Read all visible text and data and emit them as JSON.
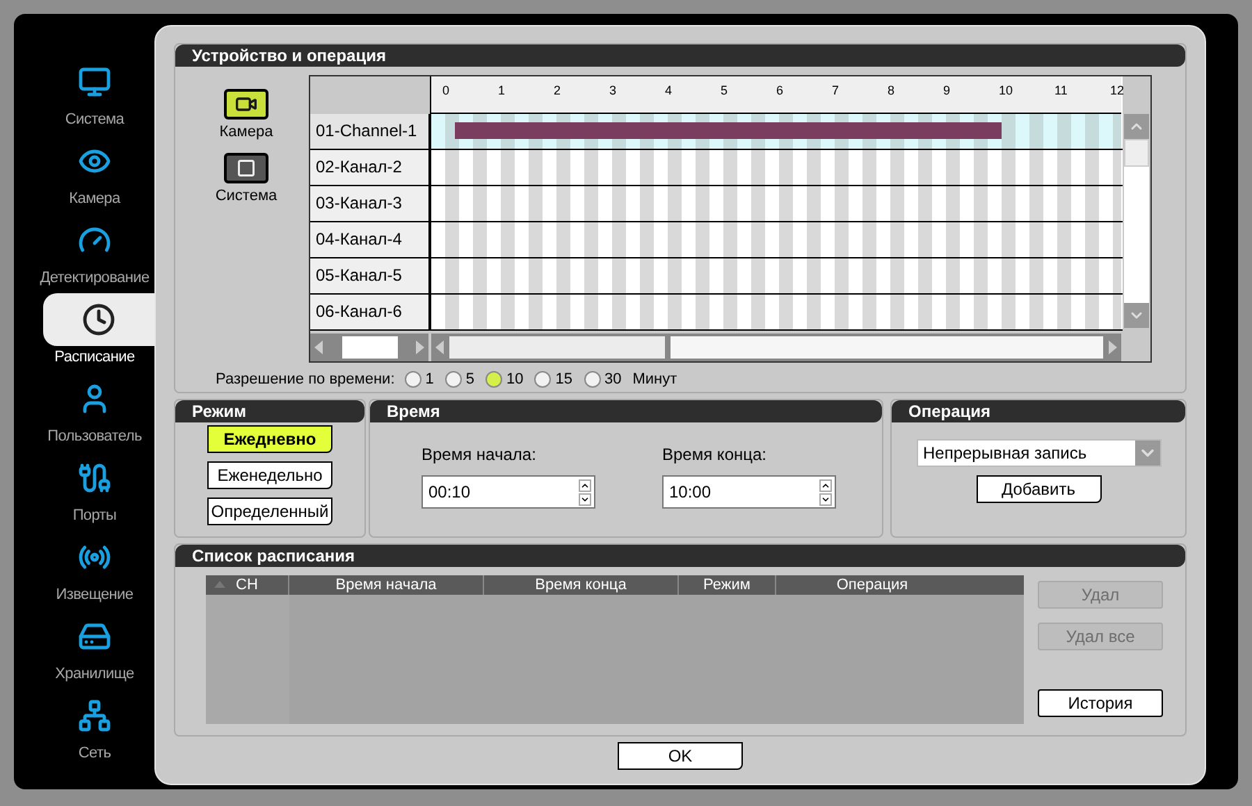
{
  "sidebar": {
    "items": [
      {
        "label": "Система",
        "selected": false
      },
      {
        "label": "Камера",
        "selected": false
      },
      {
        "label": "Детектирование",
        "selected": false
      },
      {
        "label": "Расписание",
        "selected": true
      },
      {
        "label": "Пользователь",
        "selected": false
      },
      {
        "label": "Порты",
        "selected": false
      },
      {
        "label": "Извещение",
        "selected": false
      },
      {
        "label": "Хранилище",
        "selected": false
      },
      {
        "label": "Сеть",
        "selected": false
      }
    ]
  },
  "device_section": {
    "title": "Устройство и операция",
    "device_types": [
      {
        "label": "Камера",
        "selected": true
      },
      {
        "label": "Система",
        "selected": false
      }
    ],
    "timeline": {
      "hour_ticks": [
        "0",
        "1",
        "2",
        "3",
        "4",
        "5",
        "6",
        "7",
        "8",
        "9",
        "10",
        "11",
        "12"
      ],
      "channels": [
        {
          "name": "01-Channel-1",
          "selected": true,
          "scheduled": true
        },
        {
          "name": "02-Канал-2",
          "selected": false,
          "scheduled": false
        },
        {
          "name": "03-Канал-3",
          "selected": false,
          "scheduled": false
        },
        {
          "name": "04-Канал-4",
          "selected": false,
          "scheduled": false
        },
        {
          "name": "05-Канал-5",
          "selected": false,
          "scheduled": false
        },
        {
          "name": "06-Канал-6",
          "selected": false,
          "scheduled": false
        }
      ]
    },
    "time_resolution": {
      "label": "Разрешение по времени:",
      "options": [
        {
          "label": "1",
          "selected": false
        },
        {
          "label": "5",
          "selected": false
        },
        {
          "label": "10",
          "selected": true
        },
        {
          "label": "15",
          "selected": false
        },
        {
          "label": "30",
          "selected": false
        }
      ],
      "unit": "Минут"
    }
  },
  "mode_section": {
    "title": "Режим",
    "modes": [
      {
        "label": "Ежедневно",
        "selected": true
      },
      {
        "label": "Еженедельно",
        "selected": false
      },
      {
        "label": "Определенный",
        "selected": false
      }
    ]
  },
  "time_section": {
    "title": "Время",
    "start": {
      "label": "Время начала:",
      "value": "00:10"
    },
    "end": {
      "label": "Время конца:",
      "value": "10:00"
    }
  },
  "operation_section": {
    "title": "Операция",
    "operation": {
      "value": "Непрерывная запись"
    },
    "add_button": "Добавить"
  },
  "schedule_list": {
    "title": "Список расписания",
    "columns": [
      "CH",
      "Время начала",
      "Время конца",
      "Режим",
      "Операция"
    ],
    "buttons": [
      {
        "label": "Удал",
        "disabled": true
      },
      {
        "label": "Удал все",
        "disabled": true
      },
      {
        "label": "История",
        "disabled": false
      }
    ]
  },
  "ok_button": "OK"
}
